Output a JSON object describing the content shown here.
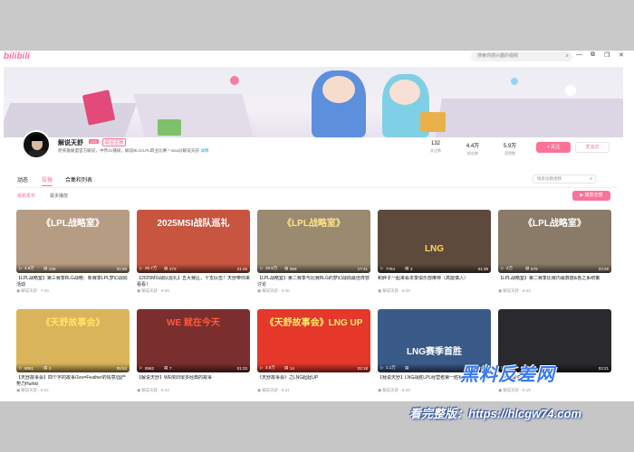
{
  "app": {
    "logo": "bilibili",
    "search_placeholder": "搜索你感兴趣的视频"
  },
  "window_controls": [
    "—",
    "❐",
    "✕",
    "⧉"
  ],
  "profile": {
    "name": "解说天舒",
    "level": "LV6",
    "badge": "联合主播",
    "bio": "原英雄联盟官方解说，中传21播硕，解说BLG/LPL职业比赛 * sina@解说天舒",
    "bio_edit": "详情",
    "stats": [
      {
        "value": "132",
        "label": "关注数"
      },
      {
        "value": "4.4万",
        "label": "粉丝数"
      },
      {
        "value": "5.9万",
        "label": "获赞数"
      }
    ],
    "follow_label": "+ 关注",
    "message_label": "发消息"
  },
  "tabs": [
    {
      "label": "动态",
      "active": false
    },
    {
      "label": "投稿",
      "active": true
    },
    {
      "label": "合集和列表",
      "active": false
    }
  ],
  "video_search_placeholder": "搜索投稿视频",
  "sort": [
    {
      "label": "最新发布",
      "active": true
    },
    {
      "label": "最多播放",
      "active": false
    }
  ],
  "play_all_label": "▶ 播放全部",
  "videos": [
    {
      "thumb_text": "《LPL战略室》",
      "views": "4.8万",
      "comments": "226",
      "duration": "31:56",
      "title": "【LPL战略室】第三赛季BLG战略：新赛季LPL梦幻战局活动",
      "author": "解说天舒",
      "date": "7-20",
      "bg": "#b79c84",
      "tc": "#ffffff"
    },
    {
      "thumb_text": "2025MSI战队巡礼",
      "views": "25.7万",
      "comments": "273",
      "duration": "21:46",
      "title": "【2025MSI战队巡礼】五大赛区，十支队伍！天舒带你来看看！",
      "author": "解说天舒",
      "date": "6-29",
      "bg": "#c8553f",
      "tc": "#ffffff"
    },
    {
      "thumb_text": "《LPL战略室》",
      "views": "19.9万",
      "comments": "959",
      "duration": "17:41",
      "title": "【LPL战略室】第二赛季与比赛BLG的梦幻战局最佳阵容讨论",
      "author": "解说天舒",
      "date": "6-30",
      "bg": "#9a8a70",
      "tc": "#ffe38a"
    },
    {
      "thumb_text": "LNG",
      "views": "7764",
      "comments": "2",
      "duration": "01:38",
      "title": "和胖子一起来看本季俱乐部推特（高能慎入）",
      "author": "解说天舒",
      "date": "6-29",
      "bg": "#5e4a3d",
      "tc": "#ffd35c"
    },
    {
      "thumb_text": "《LPL战略室》",
      "views": "2万",
      "comments": "679",
      "duration": "23:28",
      "title": "【LPL战略室】第二赛季比赛内幕数据&各之系统策",
      "author": "解说天舒",
      "date": "6-23",
      "bg": "#8a7b68",
      "tc": "#ffffff"
    },
    {
      "thumb_text": "《天舒故事会》",
      "views": "8061",
      "comments": "0",
      "duration": "05:52",
      "title": "【天舒故事会】四个字的故事/1es=Feather的情意/国产势力Hurkki",
      "author": "解说天舒",
      "date": "6-22",
      "bg": "#d9b45a",
      "tc": "#ffe36b"
    },
    {
      "thumb_text": "WE 就在今天",
      "views": "8562",
      "comments": "7",
      "duration": "01:33",
      "title": "【解说天舒】WE依旧很多经典的故事",
      "author": "解说天舒",
      "date": "6-23",
      "bg": "#7b2e2e",
      "tc": "#ff5a3c"
    },
    {
      "thumb_text": "《天舒故事会》LNG UP",
      "views": "3.5万",
      "comments": "14",
      "duration": "02:18",
      "title": "《天舒故事会》之LNG起起UP",
      "author": "解说天舒",
      "date": "6-21",
      "bg": "#e5372a",
      "tc": "#ffeb6b"
    },
    {
      "thumb_text": "LNG赛季首胜",
      "views": "1.1万",
      "comments": "",
      "duration": "01:48",
      "title": "【我说天舒】LNG战胜LPL经营者第一胜赛季首胜",
      "author": "解说天舒",
      "date": "6-23",
      "bg": "#3a5a88",
      "tc": "#ffffff"
    },
    {
      "thumb_text": "",
      "views": "2.8万",
      "comments": "",
      "duration": "03:21",
      "title": "【天舒解说】",
      "author": "解说天舒",
      "date": "6-19",
      "bg": "#2a2a2e",
      "tc": "#ffffff"
    }
  ],
  "watermark": {
    "line1": "黑料反差网",
    "line2": "看完整版：https://hlcgw74.com"
  },
  "refresh_icon": "↻"
}
